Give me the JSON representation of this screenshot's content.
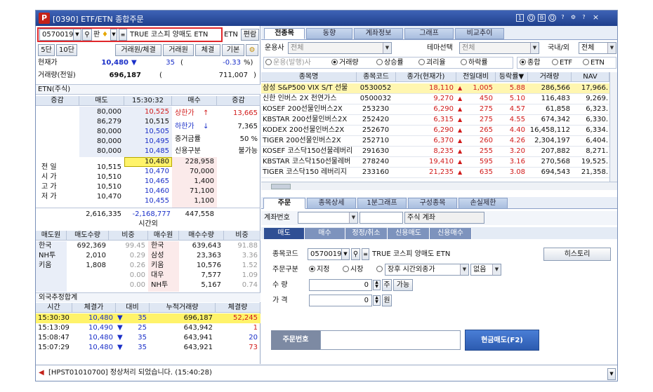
{
  "window": {
    "title": "[0390] ETF/ETN 종합주문",
    "icons": [
      "1",
      "Q",
      "B",
      "Q",
      "?",
      "⚙",
      "?",
      "×"
    ]
  },
  "left": {
    "code": "0570019",
    "pan": "판",
    "name": "TRUE 코스피 양매도 ETN",
    "etn_btn": "ETN",
    "edit_btn": "편람",
    "btn5": "5단",
    "btn10": "10단",
    "tabs": [
      "거래원/체결",
      "거래원",
      "체결",
      "기본"
    ],
    "cur_label": "현재가",
    "cur_price": "10,480",
    "cur_arrow": "▼",
    "cur_change": "35",
    "cur_paren": "(",
    "cur_rate": "-0.33",
    "cur_pct": "%)",
    "vol_label": "거래량(전일)",
    "vol": "696,187",
    "vol_paren": "(",
    "vol_prev": "711,007",
    "vol_close": ")",
    "etn_label": "ETN(주식)",
    "ob_headers": [
      "증감",
      "매도",
      "15:30:32",
      "매수",
      "증감"
    ],
    "ask": [
      {
        "q": "80,000",
        "p": "10,525"
      },
      {
        "q": "86,279",
        "p": "10,515"
      },
      {
        "q": "80,000",
        "p": "10,505"
      },
      {
        "q": "80,000",
        "p": "10,495"
      },
      {
        "q": "80,000",
        "p": "10,485"
      }
    ],
    "bid": [
      {
        "p": "10,480",
        "q": "228,958"
      },
      {
        "p": "10,470",
        "q": "70,000"
      },
      {
        "p": "10,465",
        "q": "1,400"
      },
      {
        "p": "10,460",
        "q": "71,100"
      },
      {
        "p": "10,455",
        "q": "1,100"
      }
    ],
    "upper_label": "상한가",
    "upper_arrow": "↑",
    "upper_val": "13,665",
    "lower_label": "하한가",
    "lower_arrow": "↓",
    "lower_val": "7,365",
    "margin_label": "증거금률",
    "margin_val": "50 %",
    "credit_label": "신용구분",
    "credit_val": "불가능",
    "ohlc": [
      {
        "l": "전 일",
        "v": "10,515"
      },
      {
        "l": "시 가",
        "v": "10,510"
      },
      {
        "l": "고 가",
        "v": "10,510"
      },
      {
        "l": "저 가",
        "v": "10,470"
      }
    ],
    "tot_ask": "2,616,335",
    "tot_diff": "-2,168,777",
    "tot_bid": "447,558",
    "after_label": "시간외",
    "br_headers": [
      "매도원",
      "매도수량",
      "비중",
      "매수원",
      "매수수량",
      "비중"
    ],
    "brokers": [
      {
        "s": "한국",
        "sq": "692,369",
        "sp": "99.45",
        "b": "한국",
        "bq": "639,643",
        "bp": "91.88"
      },
      {
        "s": "NH투",
        "sq": "2,010",
        "sp": "0.29",
        "b": "삼성",
        "bq": "23,363",
        "bp": "3.36"
      },
      {
        "s": "키움",
        "sq": "1,808",
        "sp": "0.26",
        "b": "키움",
        "bq": "10,576",
        "bp": "1.52"
      },
      {
        "s": "",
        "sq": "",
        "sp": "0.00",
        "b": "대우",
        "bq": "7,577",
        "bp": "1.09"
      },
      {
        "s": "",
        "sq": "",
        "sp": "0.00",
        "b": "NH투",
        "bq": "5,167",
        "bp": "0.74"
      }
    ],
    "foreign_label": "외국추정합계",
    "tr_headers": [
      "시간",
      "체결가",
      "대비",
      "누적거래량",
      "체결량"
    ],
    "trades": [
      {
        "t": "15:30:30",
        "p": "10,480",
        "a": "▼",
        "d": "35",
        "cum": "696,187",
        "v": "52,245"
      },
      {
        "t": "15:13:09",
        "p": "10,490",
        "a": "▼",
        "d": "25",
        "cum": "643,942",
        "v": "1"
      },
      {
        "t": "15:08:47",
        "p": "10,480",
        "a": "▼",
        "d": "35",
        "cum": "643,941",
        "v": "20"
      },
      {
        "t": "15:07:29",
        "p": "10,480",
        "a": "▼",
        "d": "35",
        "cum": "643,921",
        "v": "73"
      }
    ]
  },
  "right": {
    "tabs": [
      "전종목",
      "동향",
      "계좌정보",
      "그래프",
      "비교추이"
    ],
    "op_label": "운용사",
    "op_val": "전체",
    "theme_label": "테마선택",
    "theme_val": "전체",
    "dom_label": "국내/외",
    "dom_val": "전체",
    "radios1": [
      "운용(발행)사",
      "거래량",
      "상승률",
      "괴리율",
      "하락률"
    ],
    "radios2": [
      "종합",
      "ETF",
      "ETN"
    ],
    "headers": [
      "종목명",
      "종목코드",
      "종가(현재가)",
      "전일대비",
      "등락률▼",
      "거래량",
      "NAV"
    ],
    "rows": [
      {
        "n": "삼성 S&P500 VIX S/T 선물",
        "c": "0530052",
        "p": "18,110",
        "d": "1,005",
        "r": "5.88",
        "v": "286,566",
        "nav": "17,966."
      },
      {
        "n": "신한 인버스 2X 천연가스",
        "c": "0500032",
        "p": "9,270",
        "d": "450",
        "r": "5.10",
        "v": "116,483",
        "nav": "9,269."
      },
      {
        "n": "KOSEF 200선물인버스2X",
        "c": "253230",
        "p": "6,290",
        "d": "275",
        "r": "4.57",
        "v": "61,858",
        "nav": "6,323."
      },
      {
        "n": "KBSTAR 200선물인버스2X",
        "c": "252420",
        "p": "6,315",
        "d": "275",
        "r": "4.55",
        "v": "674,342",
        "nav": "6,330."
      },
      {
        "n": "KODEX 200선물인버스2X",
        "c": "252670",
        "p": "6,290",
        "d": "265",
        "r": "4.40",
        "v": "16,458,112",
        "nav": "6,334."
      },
      {
        "n": "TIGER 200선물인버스2X",
        "c": "252710",
        "p": "6,370",
        "d": "260",
        "r": "4.26",
        "v": "2,304,197",
        "nav": "6,404."
      },
      {
        "n": "KOSEF 코스닥150선물레버리",
        "c": "291630",
        "p": "8,235",
        "d": "255",
        "r": "3.20",
        "v": "207,882",
        "nav": "8,271."
      },
      {
        "n": "KBSTAR 코스닥150선물레버",
        "c": "278240",
        "p": "19,410",
        "d": "595",
        "r": "3.16",
        "v": "270,568",
        "nav": "19,525."
      },
      {
        "n": "TIGER 코스닥150 레버리지",
        "c": "233160",
        "p": "21,235",
        "d": "635",
        "r": "3.08",
        "v": "694,543",
        "nav": "21,358."
      }
    ],
    "order_tabs": [
      "주문",
      "종목상세",
      "1분그래프",
      "구성종목",
      "손실제한"
    ],
    "acct_label": "계좌번호",
    "acct_name": "주식 계좌",
    "sub_tabs": [
      "매도",
      "매수",
      "정정/취소",
      "신용매도",
      "신용매수"
    ],
    "code_label": "종목코드",
    "code": "0570019",
    "name": "TRUE 코스피 양매도 ETN",
    "history_btn": "히스토리",
    "type_label": "주문구분",
    "type_opts": [
      "지정",
      "시장"
    ],
    "type_select": "장후 시간외종가",
    "cond_select": "없음",
    "qty_label": "수   량",
    "qty": "0",
    "qty_btn1": "주",
    "qty_btn2": "가능",
    "price_label": "가   격",
    "price": "0",
    "price_btn": "원",
    "ordno_label": "주문번호",
    "sell_btn": "현금매도(F2)"
  },
  "status": {
    "msg": "[HPST01010700] 정상처리 되었습니다. (15:40:28)"
  },
  "colors": {
    "title": "#2a4b9b",
    "red": "#d11a1a",
    "blue": "#1a2fc8",
    "sell_btn": "#3a6bc4",
    "highlight_red": "#e0272a"
  }
}
